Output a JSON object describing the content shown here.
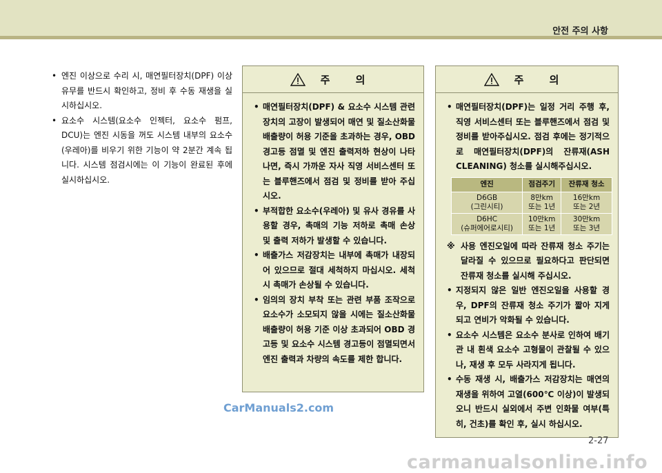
{
  "header": {
    "title": "안전 주의 사항"
  },
  "left": {
    "items": [
      "엔진 이상으로 수리 시, 매연필터장치(DPF) 이상 유무를 반드시 확인하고, 정비 후 수동 재생을 실시하십시오.",
      "요소수 시스템(요소수 인젝터, 요소수 펌프, DCU)는 엔진 시동을 꺼도 시스템 내부의 요소수(우레아)를 비우기 위한 기능이 약 2분간 계속 됩니다. 시스템 점검시에는 이 기능이 완료된 후에 실시하십시오."
    ]
  },
  "caution_mid": {
    "title": "주 의",
    "items": [
      "매연필터장치(DPF) & 요소수 시스템 관련 장치의 고장이 발생되어 매연 및 질소산화물 배출량이 허용 기준을 초과하는 경우, OBD 경고등 점멸 및 엔진 출력저하 현상이 나타나면, 즉시 가까운 자사 직영 서비스센터 또는 블루핸즈에서 점검 및 정비를 받아 주십시오.",
      "부적합한 요소수(우레아) 및 유사 경유를 사용할 경우, 촉매의 기능 저하로 촉매 손상 및 출력 저하가 발생할 수 있습니다.",
      "배출가스 저감장치는 내부에 촉매가 내장되어 있으므로 절대 세척하지 마십시오. 세척 시 촉매가 손상될 수 있습니다.",
      "임의의 장치 부착 또는 관련 부품 조작으로 요소수가 소모되지 않을 시에는 질소산화물 배출량이 허용 기준 이상 초과되어 OBD 경고등 및 요소수 시스템 경고등이 점멸되면서 엔진 출력과 차량의 속도를 제한 합니다."
    ]
  },
  "caution_right": {
    "title": "주 의",
    "intro": "매연필터장치(DPF)는 일정 거리 주행 후, 직영 서비스센터 또는 블루핸즈에서 점검 및 정비를 받아주십시오. 점검 후에는 정기적으로 매연필터장치(DPF)의 잔류재(ASH CLEANING) 청소를 실시해주십시오.",
    "table": {
      "headers": [
        "엔진",
        "점검주기",
        "잔류재 청소"
      ],
      "rows": [
        [
          "D6GB\n(그린시티)",
          "8만km\n또는 1년",
          "16만km\n또는 2년"
        ],
        [
          "D6HC\n(슈퍼에어로시티)",
          "10만km\n또는 1년",
          "30만km\n또는 3년"
        ]
      ]
    },
    "note_mark": "※",
    "note": "사용 엔진오일에 따라 잔류재 청소 주기는 달라질 수 있으므로 필요하다고 판단되면 잔류재 청소를 실시해 주십시오.",
    "items": [
      "지정되지 않은 일반 엔진오일을 사용할 경우, DPF의 잔류재 청소 주기가 짧아 지게 되고 연비가 악화될 수 있습니다.",
      "요소수 시스템은 요소수 분사로 인하여 배기관 내 흰색 요소수 고형물이 관찰될 수 있으나, 재생 후 모두 사라지게 됩니다.",
      "수동 재생 시, 배출가스 저감장치는 매연의 재생을 위하여 고열(600℃ 이상)이 발생되오니 반드시 실외에서 주변 인화물 여부(특히, 건초)를 확인 후, 실시 하십시오."
    ]
  },
  "footer": {
    "watermark": "CarManuals2.com",
    "page_number": "2-27",
    "site": "carmanualsonline.info"
  }
}
